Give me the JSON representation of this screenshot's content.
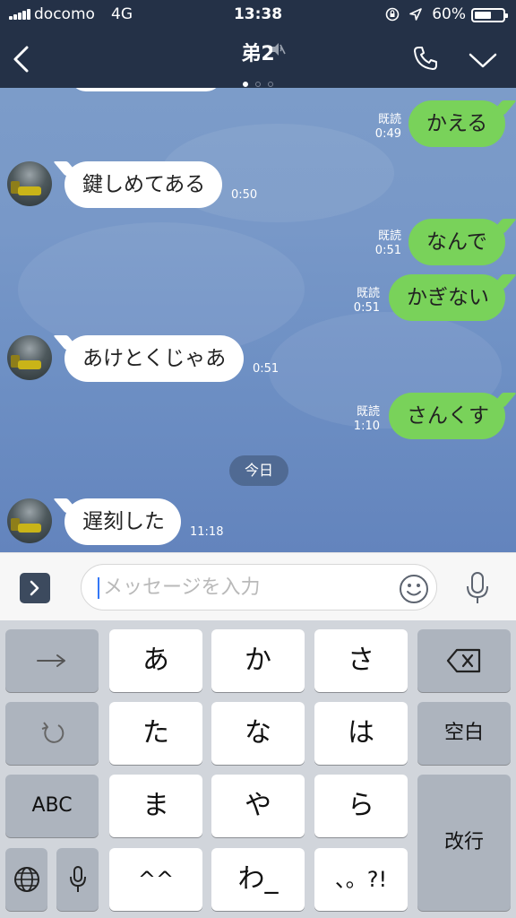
{
  "status_bar": {
    "carrier": "docomo",
    "network": "4G",
    "time": "13:38",
    "battery_percent": "60%",
    "battery_level": 0.6,
    "icons": [
      "signal-icon",
      "orientation-lock-icon",
      "location-icon",
      "battery-icon"
    ]
  },
  "header": {
    "title": "弟2",
    "page_count": 3,
    "active_page": 1,
    "icons": [
      "back-icon",
      "mute-icon",
      "phone-icon",
      "chevron-down-icon"
    ]
  },
  "messages": [
    {
      "side": "out",
      "text": "かえる",
      "read": "既読",
      "time": "0:49"
    },
    {
      "side": "in",
      "text": "鍵しめてある",
      "time": "0:50"
    },
    {
      "side": "out",
      "text": "なんで",
      "read": "既読",
      "time": "0:51"
    },
    {
      "side": "out",
      "text": "かぎない",
      "read": "既読",
      "time": "0:51"
    },
    {
      "side": "in",
      "text": "あけとくじゃあ",
      "time": "0:51"
    },
    {
      "side": "out",
      "text": "さんくす",
      "read": "既読",
      "time": "1:10"
    },
    {
      "side": "in",
      "text": "遅刻した",
      "time": "11:18"
    }
  ],
  "date_separator": "今日",
  "input": {
    "placeholder": "メッセージを入力",
    "icons": [
      "expand-icon",
      "emoji-icon",
      "microphone-icon"
    ]
  },
  "keyboard": {
    "row1": [
      "あ",
      "か",
      "さ"
    ],
    "row2": [
      "た",
      "な",
      "は"
    ],
    "row3": [
      "ま",
      "や",
      "ら"
    ],
    "row4": [
      "^^",
      "わ_",
      "、。?!"
    ],
    "abc": "ABC",
    "space": "空白",
    "enter": "改行",
    "icons": [
      "arrow-right-icon",
      "undo-icon",
      "globe-icon",
      "keyboard-mic-icon",
      "backspace-icon"
    ]
  }
}
